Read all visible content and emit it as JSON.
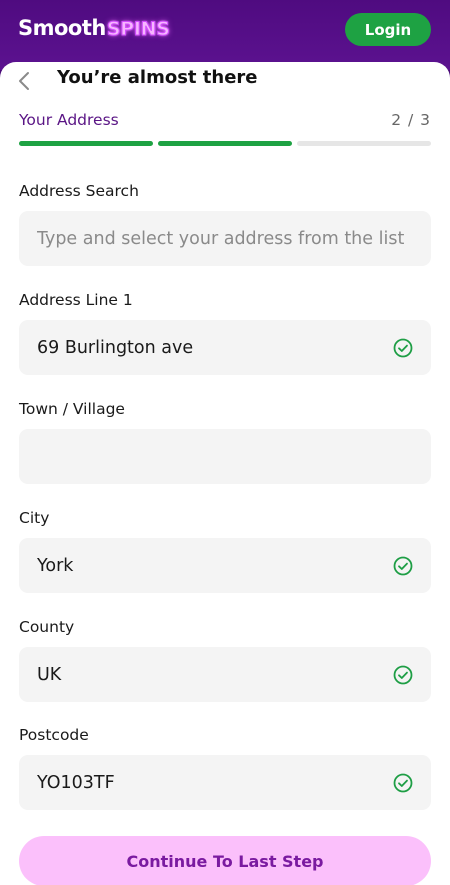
{
  "header": {
    "logo_primary": "Smooth",
    "logo_secondary": "SPINS",
    "login_label": "Login"
  },
  "page": {
    "title": "You’re almost there",
    "step_label": "Your Address",
    "step_count": "2 / 3",
    "progress": {
      "current_step": 2,
      "total_steps": 3
    }
  },
  "form": {
    "address_search": {
      "label": "Address Search",
      "placeholder": "Type and select your address from the list",
      "value": ""
    },
    "address_line_1": {
      "label": "Address Line 1",
      "value": "69 Burlington ave",
      "valid": true
    },
    "town": {
      "label": "Town / Village",
      "value": "",
      "valid": false
    },
    "city": {
      "label": "City",
      "value": "York",
      "valid": true
    },
    "county": {
      "label": "County",
      "value": "UK",
      "valid": true
    },
    "postcode": {
      "label": "Postcode",
      "value": "YO103TF",
      "valid": true
    }
  },
  "actions": {
    "continue_label": "Continue To Last Step"
  },
  "colors": {
    "brand_purple": "#4f0b80",
    "accent_green": "#1ea243",
    "cta_pink": "#fbc0fb",
    "cta_text": "#7a1aa0"
  },
  "icons": {
    "back": "chevron-left-icon",
    "valid": "check-circle-icon"
  }
}
